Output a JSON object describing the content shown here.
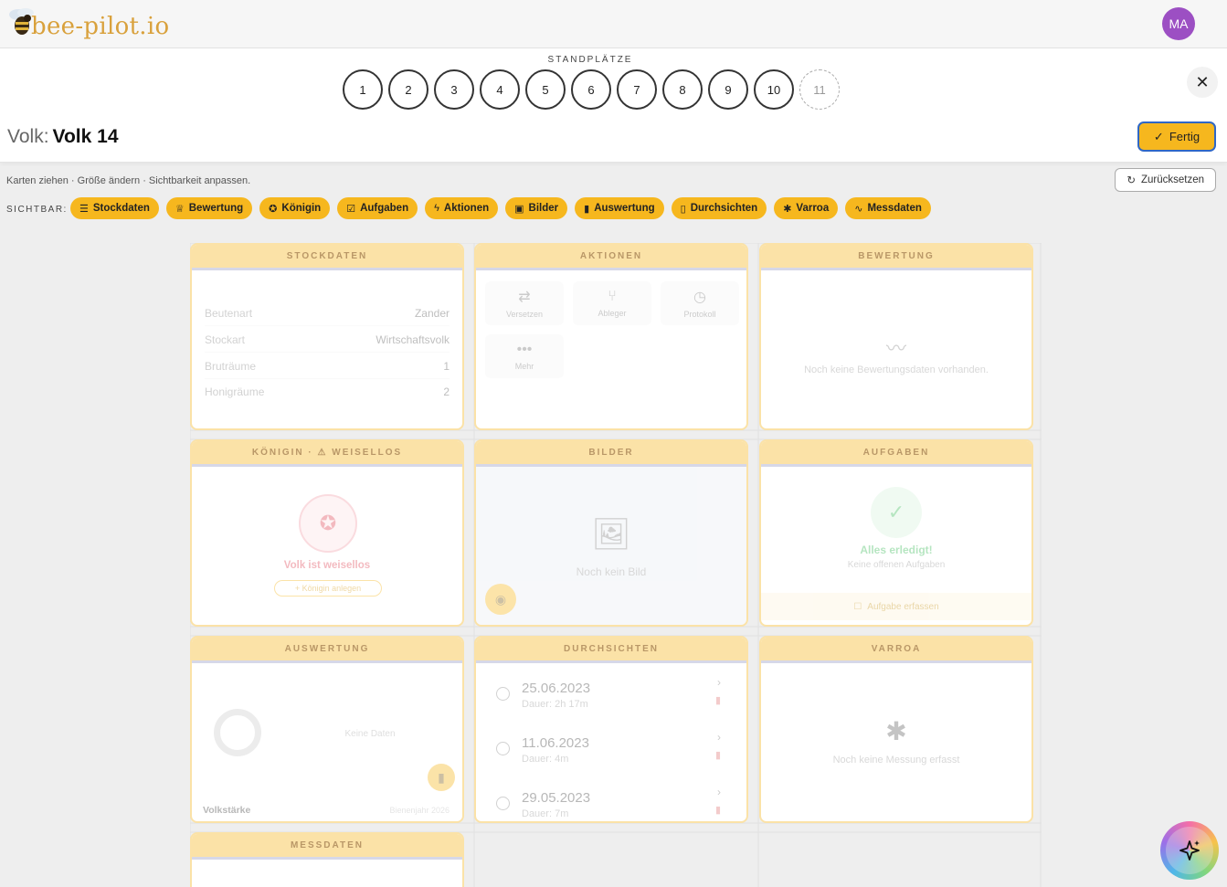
{
  "app": {
    "logo_text": "bee-pilot.io",
    "avatar_initials": "MA"
  },
  "standplaetze": {
    "label": "STANDPLÄTZE",
    "items": [
      "1",
      "2",
      "3",
      "4",
      "5",
      "6",
      "7",
      "8",
      "9",
      "10"
    ],
    "add_item": "11"
  },
  "volk": {
    "prefix": "Volk:",
    "name": "Volk 14"
  },
  "buttons": {
    "close": "✕",
    "done": "Fertig",
    "done_icon": "check-icon",
    "reset": "Zurücksetzen"
  },
  "toolbar": {
    "hint": "Karten ziehen · Größe ändern · Sichtbarkeit anpassen.",
    "visible_label": "SICHTBAR:",
    "chips": [
      {
        "label": "Stockdaten",
        "icon": "list-icon",
        "glyph": "☰"
      },
      {
        "label": "Bewertung",
        "icon": "trophy-icon",
        "glyph": "♕"
      },
      {
        "label": "Königin",
        "icon": "award-icon",
        "glyph": "✪"
      },
      {
        "label": "Aufgaben",
        "icon": "checkbox-icon",
        "glyph": "☑"
      },
      {
        "label": "Aktionen",
        "icon": "bolt-icon",
        "glyph": "ϟ"
      },
      {
        "label": "Bilder",
        "icon": "images-icon",
        "glyph": "▣"
      },
      {
        "label": "Auswertung",
        "icon": "bar-chart-icon",
        "glyph": "▮"
      },
      {
        "label": "Durchsichten",
        "icon": "clipboard-icon",
        "glyph": "▯"
      },
      {
        "label": "Varroa",
        "icon": "bug-icon",
        "glyph": "✱"
      },
      {
        "label": "Messdaten",
        "icon": "trend-icon",
        "glyph": "∿"
      }
    ]
  },
  "cards": {
    "stockdaten": {
      "title": "STOCKDATEN",
      "rows": [
        {
          "key": "Beutenart",
          "value": "Zander"
        },
        {
          "key": "Stockart",
          "value": "Wirtschaftsvolk"
        },
        {
          "key": "Bruträume",
          "value": "1"
        },
        {
          "key": "Honigräume",
          "value": "2"
        }
      ]
    },
    "aktionen": {
      "title": "AKTIONEN",
      "tiles": [
        {
          "label": "Versetzen",
          "glyph": "⇄"
        },
        {
          "label": "Ableger",
          "glyph": "⑂"
        },
        {
          "label": "Protokoll",
          "glyph": "◷"
        },
        {
          "label": "Mehr",
          "glyph": "•••"
        }
      ]
    },
    "bewertung": {
      "title": "BEWERTUNG",
      "empty": "Noch keine Bewertungsdaten vorhanden."
    },
    "koenigin": {
      "title": "KÖNIGIN · ⚠ WEISELLOS",
      "status": "Volk ist weisellos",
      "action": "+ Königin anlegen"
    },
    "bilder": {
      "title": "BILDER",
      "empty": "Noch kein Bild"
    },
    "aufgaben": {
      "title": "AUFGABEN",
      "status": "Alles erledigt!",
      "sub": "Keine offenen Aufgaben",
      "action": "Aufgabe erfassen"
    },
    "auswertung": {
      "title": "AUSWERTUNG",
      "empty": "Keine Daten",
      "footer_label": "Volkstärke",
      "footer_value": "Bienenjahr 2026"
    },
    "durchsichten": {
      "title": "DURCHSICHTEN",
      "items": [
        {
          "date": "25.06.2023",
          "duration": "Dauer: 2h 17m"
        },
        {
          "date": "11.06.2023",
          "duration": "Dauer: 4m"
        },
        {
          "date": "29.05.2023",
          "duration": "Dauer: 7m"
        }
      ]
    },
    "varroa": {
      "title": "VARROA",
      "empty": "Noch keine Messung erfasst"
    },
    "messdaten": {
      "title": "MESSDATEN"
    }
  },
  "colors": {
    "accent": "#f6b71e",
    "card_head": "#fbe2a7",
    "avatar": "#9c4fc3",
    "focus": "#2f67c6"
  }
}
